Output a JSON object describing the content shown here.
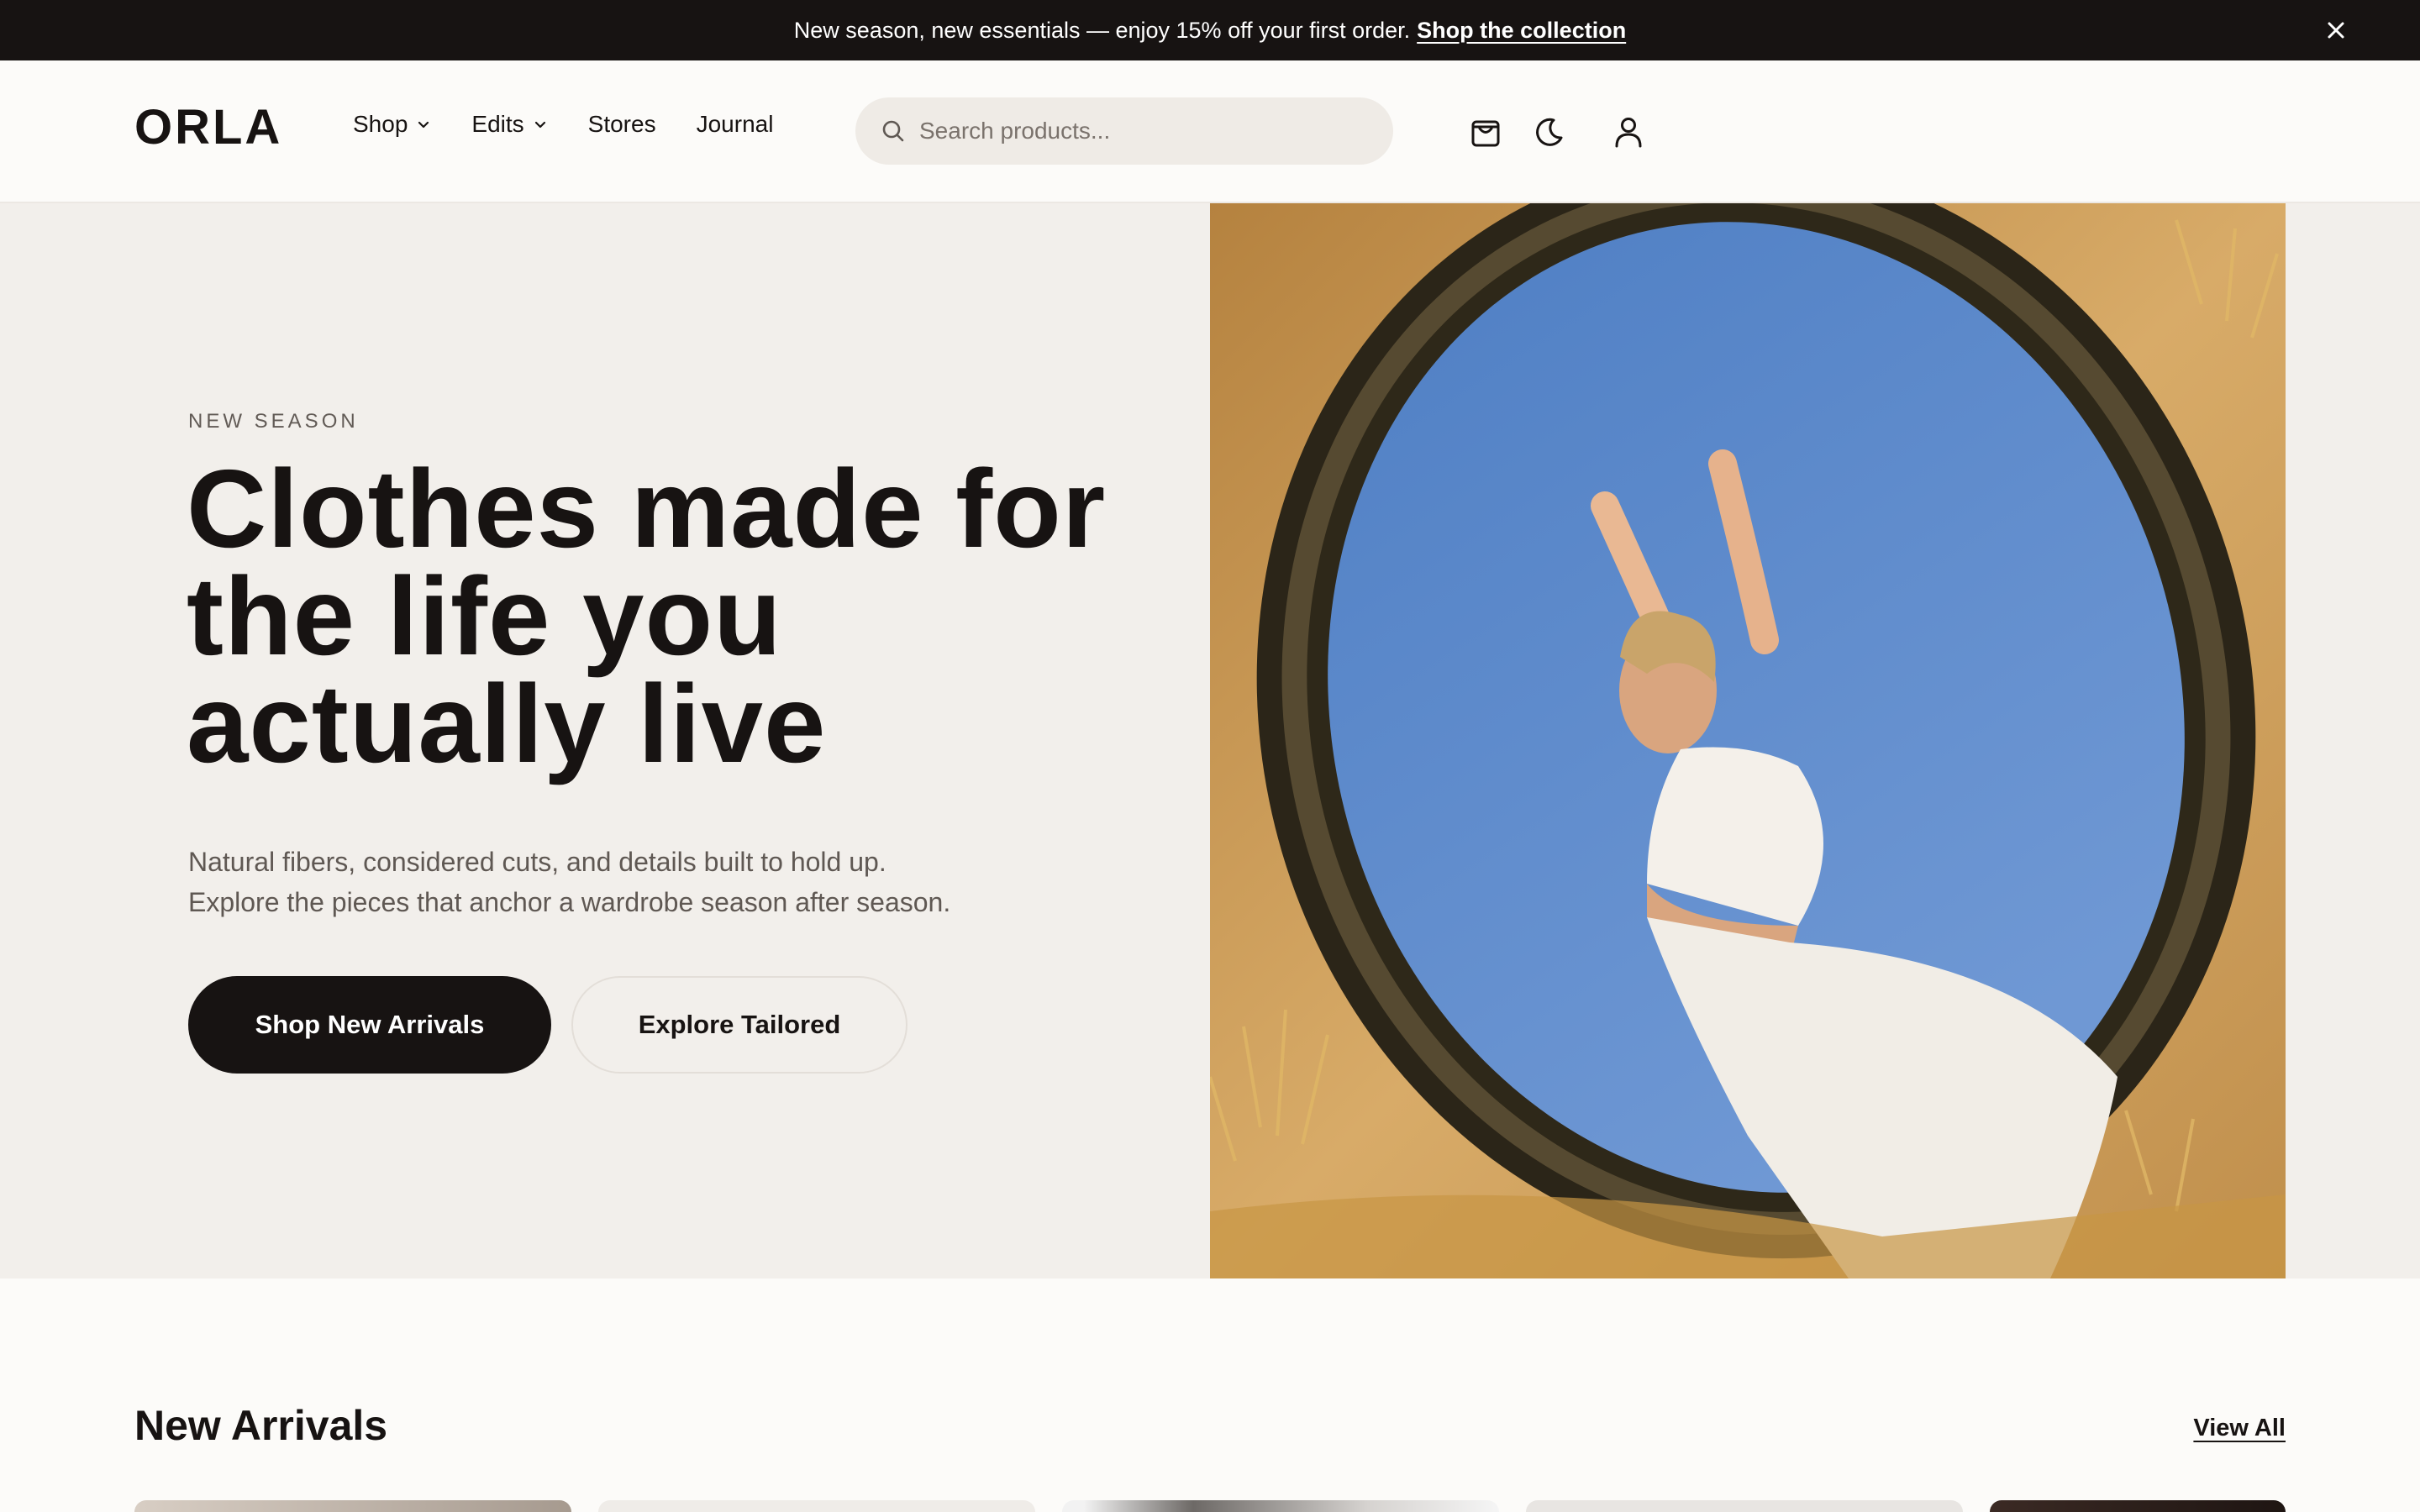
{
  "announcement": {
    "message": "New season, new essentials — enjoy 15% off your first order.",
    "link_label": "Shop the collection"
  },
  "header": {
    "logo": "ORLA",
    "nav": [
      {
        "label": "Shop",
        "has_dropdown": true
      },
      {
        "label": "Edits",
        "has_dropdown": true
      },
      {
        "label": "Stores",
        "has_dropdown": false
      },
      {
        "label": "Journal",
        "has_dropdown": false
      }
    ],
    "search": {
      "placeholder": "Search products..."
    },
    "icons": [
      "shopping-bag-icon",
      "moon-icon",
      "user-icon"
    ]
  },
  "hero": {
    "eyebrow": "NEW SEASON",
    "headline": "Clothes made for the life you actually live",
    "subcopy_line1": "Natural fibers, considered cuts, and details built to hold up.",
    "subcopy_line2": "Explore the pieces that anchor a wardrobe season after season.",
    "primary_cta": "Shop New Arrivals",
    "secondary_cta": "Explore Tailored"
  },
  "arrivals": {
    "title": "New Arrivals",
    "view_all": "View All"
  },
  "colors": {
    "dark": "#171312",
    "page_bg": "#fcfbf9",
    "hero_bg": "#f2efeb",
    "sky": "#5b87c9",
    "sand": "#d2a564"
  }
}
